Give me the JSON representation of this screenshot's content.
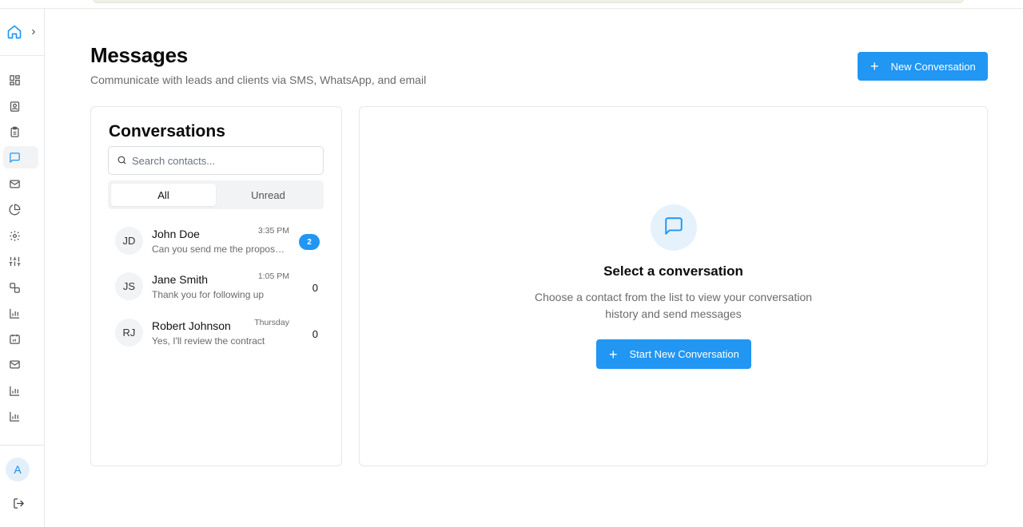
{
  "colors": {
    "accent": "#2196f3",
    "active_nav_bg": "#f1f3f5",
    "badge_bg": "#2196f3"
  },
  "sidebar": {
    "home_icon": "home-icon",
    "expand_icon": "chevron-right-icon",
    "items": [
      {
        "icon": "dashboard-icon",
        "active": false
      },
      {
        "icon": "contacts-icon",
        "active": false
      },
      {
        "icon": "clipboard-icon",
        "active": false
      },
      {
        "icon": "message-icon",
        "active": true
      },
      {
        "icon": "mail-icon",
        "active": false
      },
      {
        "icon": "pie-chart-icon",
        "active": false
      },
      {
        "icon": "settings-icon",
        "active": false
      },
      {
        "icon": "sliders-icon",
        "active": false
      },
      {
        "icon": "integrations-icon",
        "active": false
      },
      {
        "icon": "bar-chart-icon",
        "active": false
      },
      {
        "icon": "calendar-icon",
        "active": false
      },
      {
        "icon": "mail-icon",
        "active": false
      },
      {
        "icon": "bar-chart-icon",
        "active": false
      },
      {
        "icon": "bar-chart-icon",
        "active": false
      }
    ],
    "user_initial": "A",
    "logout_icon": "logout-icon"
  },
  "header": {
    "title": "Messages",
    "subtitle": "Communicate with leads and clients via SMS, WhatsApp, and email",
    "new_conversation_label": "New Conversation"
  },
  "conversations": {
    "title": "Conversations",
    "search_placeholder": "Search contacts...",
    "tabs": [
      {
        "label": "All",
        "active": true
      },
      {
        "label": "Unread",
        "active": false
      }
    ],
    "items": [
      {
        "initials": "JD",
        "name": "John Doe",
        "preview": "Can you send me the proposal?",
        "time": "3:35 PM",
        "unread": "2",
        "badge": true
      },
      {
        "initials": "JS",
        "name": "Jane Smith",
        "preview": "Thank you for following up",
        "time": "1:05 PM",
        "unread": "0",
        "badge": false
      },
      {
        "initials": "RJ",
        "name": "Robert Johnson",
        "preview": "Yes, I'll review the contract",
        "time": "Thursday",
        "unread": "0",
        "badge": false
      }
    ]
  },
  "empty_state": {
    "icon": "message-icon",
    "title": "Select a conversation",
    "description": "Choose a contact from the list to view your conversation history and send messages",
    "button_label": "Start New Conversation"
  }
}
